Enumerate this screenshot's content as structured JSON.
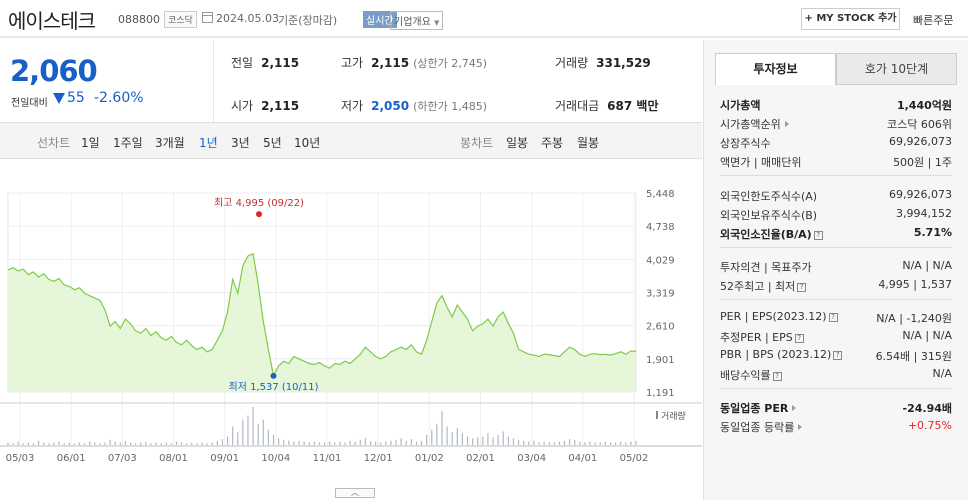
{
  "header": {
    "name": "에이스테크",
    "code": "088800",
    "market": "코스닥",
    "date": "2024.05.03",
    "basis": "기준(장마감)",
    "realtime": "실시간",
    "company_overview": "기업개요",
    "mystock_btn": "+ MY STOCK 추가",
    "quick_order": "빠른주문"
  },
  "price": {
    "current": "2,060",
    "change_label": "전일대비",
    "change": "55",
    "change_pct": "-2.60%",
    "direction": "down"
  },
  "stats": {
    "prev_label": "전일",
    "prev": "2,115",
    "high_label": "고가",
    "high": "2,115",
    "upper_limit": "(상한가 2,745)",
    "volume_label": "거래량",
    "volume": "331,529",
    "open_label": "시가",
    "open": "2,115",
    "low_label": "저가",
    "low": "2,050",
    "lower_limit": "(하한가 1,485)",
    "amount_label": "거래대금",
    "amount": "687 백만"
  },
  "periods": {
    "line_label": "선차트",
    "line": [
      "1일",
      "1주일",
      "3개월",
      "1년",
      "3년",
      "5년",
      "10년"
    ],
    "active": "1년",
    "candle_label": "봉차트",
    "candle": [
      "일봉",
      "주봉",
      "월봉"
    ]
  },
  "chart_data": {
    "type": "area",
    "title": "",
    "xlabel": "",
    "ylabel": "",
    "x_ticks": [
      "05/03",
      "06/01",
      "07/03",
      "08/01",
      "09/01",
      "10/04",
      "11/01",
      "12/01",
      "01/02",
      "02/01",
      "03/04",
      "04/01",
      "05/02"
    ],
    "y_ticks": [
      5448,
      4738,
      4029,
      3319,
      2610,
      1901,
      1191
    ],
    "ylim": [
      1191,
      5448
    ],
    "high_label": "최고 4,995 (09/22)",
    "low_label": "최저 1,537 (10/11)",
    "high": {
      "date": "09/22",
      "value": 4995
    },
    "low": {
      "date": "10/11",
      "value": 1537
    },
    "volume_label": "거래량",
    "series": [
      {
        "values": [
          3800,
          3850,
          3780,
          3820,
          3700,
          3760,
          3650,
          3720,
          3600,
          3560,
          3620,
          3480,
          3450,
          3380,
          3420,
          3300,
          3250,
          3200,
          3150,
          2950,
          2600,
          2700,
          2550,
          2750,
          2650,
          2500,
          2450,
          2550,
          2400,
          2480,
          2350,
          2300,
          2380,
          2250,
          2200,
          2300,
          2180,
          2100,
          2150,
          2050,
          2100,
          2300,
          2500,
          2900,
          3600,
          3300,
          3900,
          4100,
          4150,
          3500,
          2700,
          2100,
          1537,
          1750,
          1850,
          1800,
          1950,
          1900,
          1850,
          1800,
          1780,
          1820,
          1750,
          1700,
          1800,
          1780,
          1850,
          1800,
          1900,
          2000,
          2150,
          2050,
          1950,
          1900,
          1950,
          2050,
          2100,
          2150,
          2100,
          2200,
          2050,
          2000,
          2300,
          2700,
          3100,
          3250,
          3000,
          2800,
          3050,
          2900,
          2750,
          2500,
          2600,
          2650,
          2750,
          2600,
          2800,
          2900,
          2650,
          2450,
          2100,
          2050,
          2000,
          1980,
          1950,
          2000,
          1990,
          1970,
          1950,
          2050,
          2150,
          2100,
          2000,
          1950,
          2000,
          2010,
          1990,
          2000,
          1980,
          2010,
          2050,
          2000,
          2070,
          2060
        ]
      }
    ],
    "volume": [
      3,
      2,
      4,
      2,
      3,
      2,
      5,
      3,
      2,
      3,
      4,
      2,
      3,
      2,
      3,
      2,
      4,
      3,
      2,
      3,
      6,
      4,
      3,
      5,
      3,
      2,
      3,
      4,
      2,
      3,
      2,
      3,
      2,
      4,
      3,
      2,
      3,
      2,
      3,
      2,
      3,
      5,
      7,
      10,
      22,
      15,
      30,
      35,
      45,
      25,
      30,
      18,
      12,
      8,
      6,
      5,
      4,
      5,
      4,
      3,
      4,
      3,
      3,
      4,
      3,
      4,
      3,
      5,
      4,
      6,
      8,
      5,
      4,
      3,
      4,
      5,
      6,
      8,
      5,
      7,
      4,
      5,
      12,
      18,
      25,
      40,
      22,
      15,
      20,
      14,
      10,
      8,
      9,
      10,
      14,
      9,
      12,
      16,
      10,
      8,
      6,
      5,
      4,
      5,
      3,
      4,
      3,
      3,
      4,
      5,
      7,
      6,
      4,
      3,
      4,
      3,
      3,
      4,
      3,
      3,
      4,
      3,
      4,
      5
    ]
  },
  "side": {
    "tab_active": "투자정보",
    "tab_other": "호가 10단계",
    "g1": [
      {
        "l": "시가총액",
        "r": "1,440억원",
        "bold": true
      },
      {
        "l": "시가총액순위",
        "r": "코스닥 606위",
        "tri": true
      },
      {
        "l": "상장주식수",
        "r": "69,926,073"
      },
      {
        "l": "액면가 | 매매단위",
        "r": "500원 | 1주"
      }
    ],
    "g2": [
      {
        "l": "외국인한도주식수(A)",
        "r": "69,926,073"
      },
      {
        "l": "외국인보유주식수(B)",
        "r": "3,994,152"
      },
      {
        "l": "외국인소진율(B/A)",
        "r": "5.71%",
        "bold": true,
        "qm": true
      }
    ],
    "g3": [
      {
        "l": "투자의견 | 목표주가",
        "r": "N/A | N/A"
      },
      {
        "l": "52주최고 | 최저",
        "r": "4,995 | 1,537",
        "qm": true
      }
    ],
    "g4": [
      {
        "l": "PER | EPS(2023.12)",
        "r": "N/A | -1,240원",
        "qm": true
      },
      {
        "l": "추정PER | EPS",
        "r": "N/A | N/A",
        "qm": true
      },
      {
        "l": "PBR | BPS (2023.12)",
        "r": "6.54배 | 315원",
        "qm": true
      },
      {
        "l": "배당수익률",
        "r": "N/A",
        "qm": true
      }
    ],
    "g5": [
      {
        "l": "동일업종 PER",
        "r": "-24.94배",
        "bold": true,
        "tri": true
      },
      {
        "l": "동일업종 등락률",
        "r": "+0.75%",
        "red": true,
        "tri": true
      }
    ]
  },
  "colors": {
    "down": "#1860c8",
    "up": "#e0262b",
    "line": "#7ecb4a",
    "fill": "#e6f6d8"
  },
  "toggle_icon": "chevron-up-icon"
}
